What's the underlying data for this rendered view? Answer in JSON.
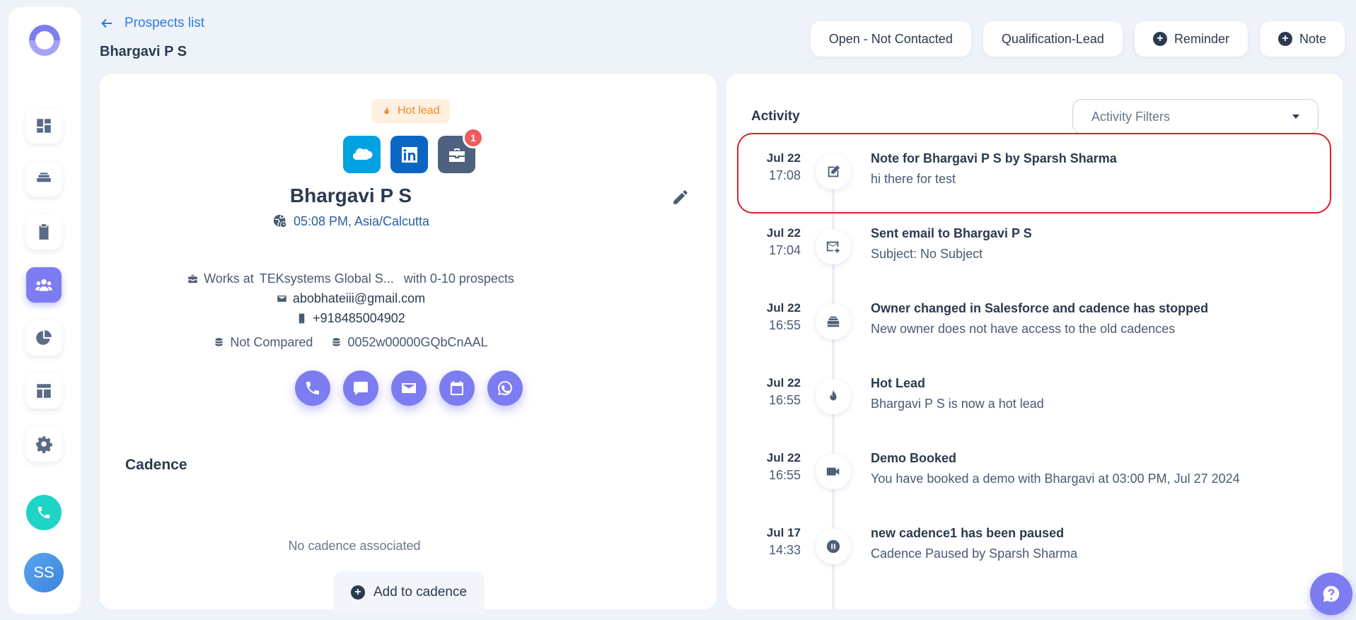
{
  "user": {
    "initials": "SS"
  },
  "header": {
    "back_label": "Prospects list",
    "title": "Bhargavi P S",
    "actions": [
      {
        "label": "Open - Not Contacted",
        "icon": ""
      },
      {
        "label": "Qualification-Lead",
        "icon": ""
      },
      {
        "label": "Reminder",
        "icon": "plus-circle-icon"
      },
      {
        "label": "Note",
        "icon": "plus-circle-icon"
      }
    ]
  },
  "prospect": {
    "badge": "Hot lead",
    "notification_count": "1",
    "name": "Bhargavi P S",
    "timezone": "05:08 PM, Asia/Calcutta",
    "works_at_prefix": "Works at",
    "company": "TEKsystems Global S...",
    "company_suffix": "with 0-10 prospects",
    "email": "abobhateiii@gmail.com",
    "phone": "+918485004902",
    "compare_status": "Not Compared",
    "record_id": "0052w00000GQbCnAAL"
  },
  "cadence": {
    "title": "Cadence",
    "empty_text": "No cadence associated",
    "add_label": "Add to cadence"
  },
  "activity": {
    "title": "Activity",
    "filter_placeholder": "Activity Filters",
    "items": [
      {
        "date": "Jul 22",
        "time": "17:08",
        "icon": "edit-note-icon",
        "title": "Note for Bhargavi P S by Sparsh Sharma",
        "subtitle": "hi there for test"
      },
      {
        "date": "Jul 22",
        "time": "17:04",
        "icon": "mail-sent-icon",
        "title": "Sent email to Bhargavi P S",
        "subtitle": "Subject: No Subject"
      },
      {
        "date": "Jul 22",
        "time": "16:55",
        "icon": "stack-icon",
        "title": "Owner changed in Salesforce and cadence has stopped",
        "subtitle": "New owner does not have access to the old cadences"
      },
      {
        "date": "Jul 22",
        "time": "16:55",
        "icon": "flame-icon",
        "title": "Hot Lead",
        "subtitle": "Bhargavi P S is now a hot lead"
      },
      {
        "date": "Jul 22",
        "time": "16:55",
        "icon": "video-icon",
        "title": "Demo Booked",
        "subtitle": "You have booked a demo with Bhargavi at 03:00 PM, Jul 27 2024"
      },
      {
        "date": "Jul 17",
        "time": "14:33",
        "icon": "pause-icon",
        "title": "new cadence1 has been paused",
        "subtitle": "Cadence Paused by Sparsh Sharma"
      }
    ]
  },
  "colors": {
    "accent": "#7d7cf0",
    "link": "#2c7be5",
    "hot_lead": "#ef8a2c",
    "salesforce": "#00a1e0",
    "linkedin": "#0a66c2",
    "highlight": "#e01e2b"
  }
}
